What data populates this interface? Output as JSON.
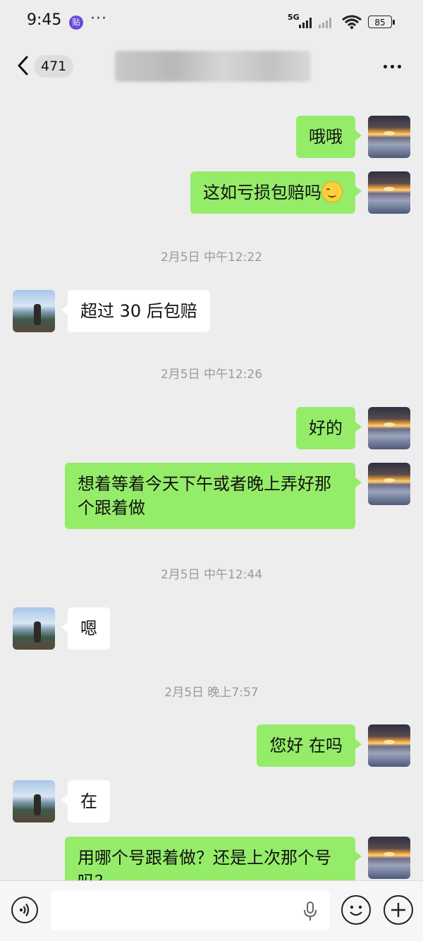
{
  "status_bar": {
    "time": "9:45",
    "app_badge": "贴",
    "dots": "···",
    "network": "5G",
    "battery": "85"
  },
  "header": {
    "back_count": "471",
    "contact_name": "",
    "more_label": "···"
  },
  "messages": [
    {
      "from": "self",
      "text": "哦哦"
    },
    {
      "from": "self",
      "text": "这如亏损包赔吗",
      "emoji": "smiley"
    },
    {
      "type": "time",
      "text": "2月5日 中午12:22"
    },
    {
      "from": "other",
      "text": "超过 30 后包赔"
    },
    {
      "type": "time",
      "text": "2月5日 中午12:26"
    },
    {
      "from": "self",
      "text": "好的"
    },
    {
      "from": "self",
      "text": "想着等着今天下午或者晚上弄好那个跟着做"
    },
    {
      "type": "time",
      "text": "2月5日 中午12:44"
    },
    {
      "from": "other",
      "text": "嗯"
    },
    {
      "type": "time",
      "text": "2月5日 晚上7:57"
    },
    {
      "from": "self",
      "text": "您好 在吗"
    },
    {
      "from": "other",
      "text": "在"
    },
    {
      "from": "self",
      "text": "用哪个号跟着做？还是上次那个号吗？"
    }
  ],
  "input_bar": {
    "placeholder": ""
  }
}
